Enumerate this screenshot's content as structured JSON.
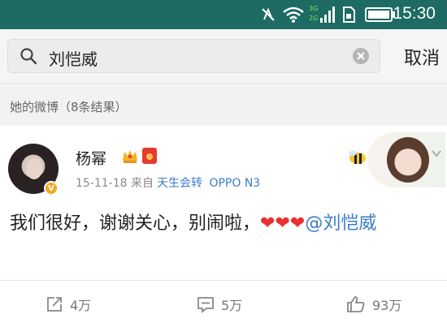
{
  "status_bar": {
    "time": "15:30",
    "network_top": "3G",
    "network_bottom": "2G",
    "icons": [
      "vibrate-mute-icon",
      "wifi-icon",
      "signal-icon",
      "sim-icon",
      "battery-icon"
    ]
  },
  "search": {
    "query": "刘恺威",
    "cancel_label": "取消"
  },
  "section": {
    "header": "她的微博（8条结果）"
  },
  "post": {
    "username": "杨幂",
    "date": "15-11-18",
    "via_label": "来自",
    "source": "天生会转",
    "device": "OPPO N3",
    "text_main": "我们很好，谢谢关心，别闹啦，",
    "hearts": "❤❤❤",
    "mention": "@刘恺威",
    "verified_mark": "V"
  },
  "actions": {
    "repost_count": "4万",
    "comment_count": "5万",
    "like_count": "93万"
  },
  "colors": {
    "status_bar": "#1d6b63",
    "link_blue": "#3a7dc9",
    "heart_red": "#e8312f",
    "verified_orange": "#f5a623"
  }
}
